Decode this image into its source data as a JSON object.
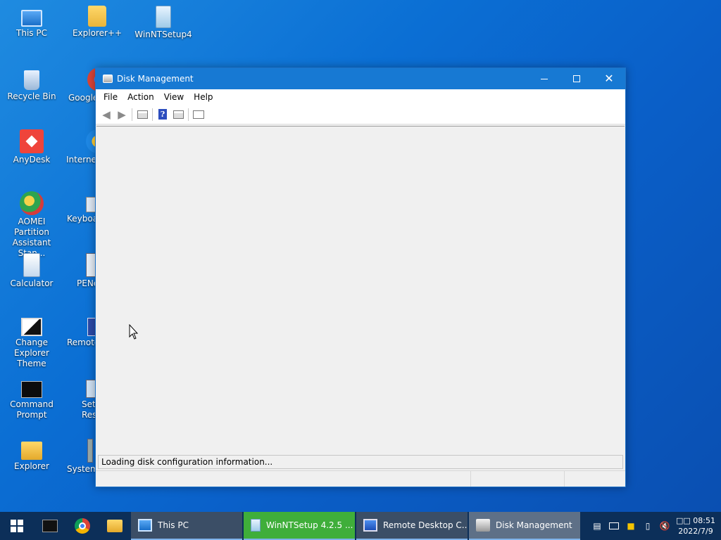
{
  "desktop": {
    "icons": [
      {
        "label": "This PC"
      },
      {
        "label": "Explorer++"
      },
      {
        "label": "WinNTSetup4"
      },
      {
        "label": "Recycle Bin"
      },
      {
        "label": "Google"
      },
      {
        "label": "AnyDesk"
      },
      {
        "label": "Internet"
      },
      {
        "label": "AOMEI Partition Assistant Stan..."
      },
      {
        "label": "Keyboa"
      },
      {
        "label": "Calculator"
      },
      {
        "label": "PENe"
      },
      {
        "label": "Change Explorer Theme"
      },
      {
        "label": "Remote"
      },
      {
        "label": "Command Prompt"
      },
      {
        "label": "Set Reso"
      },
      {
        "label": "Explorer"
      },
      {
        "label": "System"
      }
    ]
  },
  "window": {
    "title": "Disk Management",
    "menu": [
      "File",
      "Action",
      "View",
      "Help"
    ],
    "status_text": "Loading disk configuration information...",
    "controls": {
      "minimize": "—",
      "maximize": "☐",
      "close": "✕"
    }
  },
  "taskbar": {
    "tasks": [
      {
        "label": "This PC",
        "icon": "computer-icon"
      },
      {
        "label": "WinNTSetup 4.2.5   ...",
        "icon": "setup-icon"
      },
      {
        "label": "Remote Desktop C...",
        "icon": "remote-desktop-icon"
      },
      {
        "label": "Disk Management",
        "icon": "disk-management-icon"
      }
    ],
    "clock": {
      "time": "□□ 08:51",
      "date": "2022/7/9"
    }
  },
  "colors": {
    "titlebar": "#1779d3",
    "taskbar": "#0c2f59",
    "active_task": "#3fae3a"
  }
}
